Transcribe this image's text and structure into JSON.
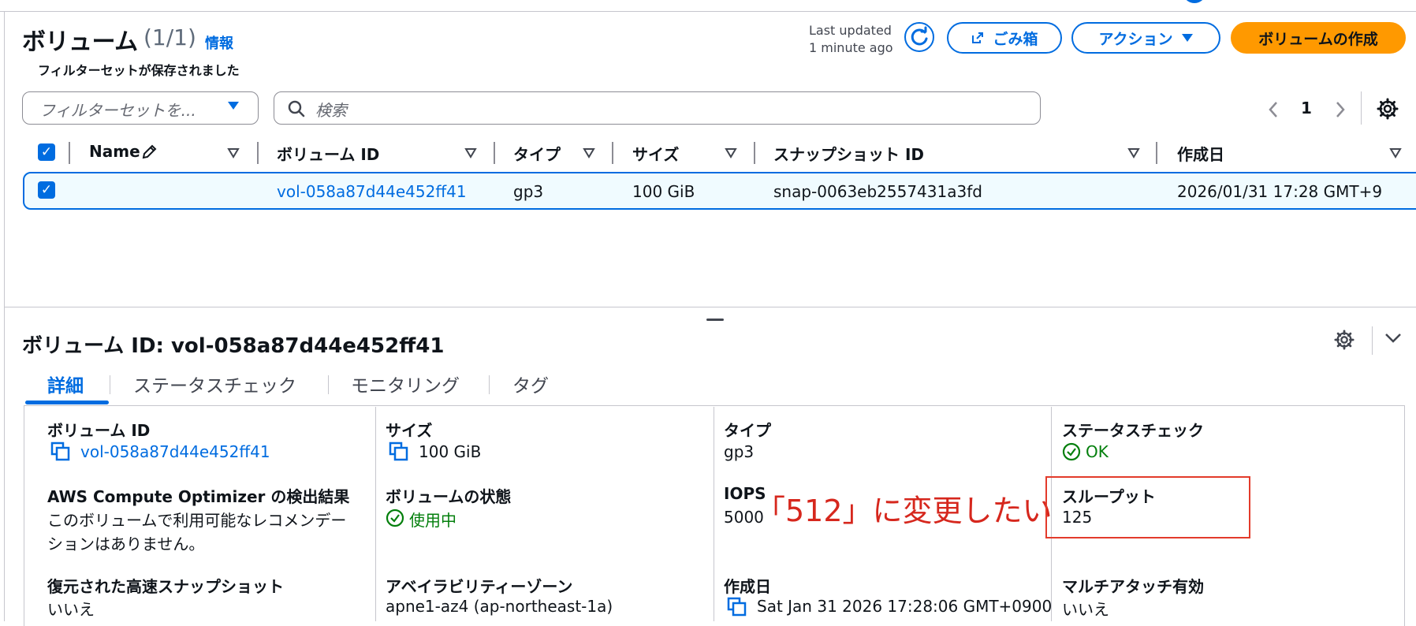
{
  "header": {
    "title": "ボリューム",
    "count": "(1/1)",
    "info_link": "情報",
    "last_updated_line1": "Last updated",
    "last_updated_line2": "1 minute ago",
    "trash_label": "ごみ箱",
    "actions_label": "アクション",
    "create_label": "ボリュームの作成"
  },
  "filters": {
    "saved_label": "フィルターセットが保存されました",
    "filter_placeholder": "フィルターセットを...",
    "search_placeholder": "検索"
  },
  "pagination": {
    "current_page": "1"
  },
  "table": {
    "columns": [
      "Name",
      "ボリューム ID",
      "タイプ",
      "サイズ",
      "スナップショット ID",
      "作成日"
    ],
    "rows": [
      {
        "name": "",
        "volume_id": "vol-058a87d44e452ff41",
        "type": "gp3",
        "size": "100 GiB",
        "snapshot_id": "snap-0063eb2557431a3fd",
        "created": "2026/01/31 17:28 GMT+9"
      }
    ]
  },
  "details": {
    "title": "ボリューム ID: vol-058a87d44e452ff41",
    "tabs": [
      "詳細",
      "ステータスチェック",
      "モニタリング",
      "タグ"
    ],
    "fields": {
      "volume_id": {
        "label": "ボリューム ID",
        "value": "vol-058a87d44e452ff41"
      },
      "size": {
        "label": "サイズ",
        "value": "100 GiB"
      },
      "type": {
        "label": "タイプ",
        "value": "gp3"
      },
      "status_check": {
        "label": "ステータスチェック",
        "value": "OK"
      },
      "optimizer": {
        "label": "AWS Compute Optimizer の検出結果",
        "value_line1": "このボリュームで利用可能なレコメンデー",
        "value_line2": "ションはありません。"
      },
      "state": {
        "label": "ボリュームの状態",
        "value": "使用中"
      },
      "iops": {
        "label": "IOPS",
        "value": "5000"
      },
      "throughput": {
        "label": "スループット",
        "value": "125"
      },
      "fast_restore": {
        "label": "復元された高速スナップショット",
        "value": "いいえ"
      },
      "az": {
        "label": "アベイラビリティーゾーン",
        "value": "apne1-az4 (ap-northeast-1a)"
      },
      "created": {
        "label": "作成日",
        "value": "Sat Jan 31 2026 17:28:06 GMT+0900"
      },
      "multi_attach": {
        "label": "マルチアタッチ有効",
        "value": "いいえ"
      }
    }
  },
  "annotation": {
    "text": "「512」に変更したい"
  },
  "colors": {
    "accent": "#006ce0",
    "primary_button": "#ff9900",
    "success": "#037f0c",
    "annotation": "#d6271d"
  }
}
